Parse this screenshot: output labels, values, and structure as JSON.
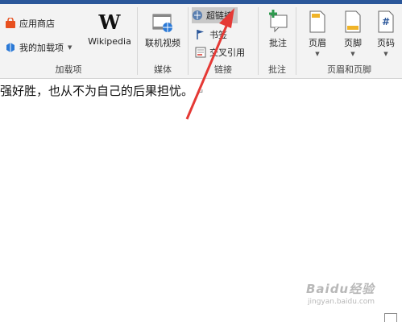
{
  "ribbon": {
    "addins": {
      "store_label": "应用商店",
      "my_addins_label": "我的加载项",
      "wikipedia_label": "Wikipedia",
      "group_label": "加载项"
    },
    "media": {
      "online_video_label": "联机视频",
      "group_label": "媒体"
    },
    "links": {
      "hyperlink_label": "超链接",
      "bookmark_label": "书签",
      "cross_ref_label": "交叉引用",
      "group_label": "链接"
    },
    "comments": {
      "comment_label": "批注",
      "group_label": "批注"
    },
    "header_footer": {
      "header_label": "页眉",
      "footer_label": "页脚",
      "page_number_label": "页码",
      "group_label": "页眉和页脚"
    }
  },
  "document": {
    "text": "强好胜，也从不为自己的后果担忧。",
    "paragraph_mark": "↵"
  },
  "watermark": {
    "main": "Baidu经验",
    "sub": "jingyan.baidu.com"
  },
  "colors": {
    "title_bar": "#2b579a",
    "ribbon_bg": "#f3f3f3",
    "arrow": "#e53935",
    "store_icon": "#e8501f",
    "addin_icon": "#2b79d6"
  },
  "icons": {
    "store": "store-icon",
    "my_addins": "my-addins-icon",
    "wikipedia": "wikipedia-icon",
    "online_video": "online-video-icon",
    "hyperlink": "hyperlink-icon",
    "bookmark": "bookmark-icon",
    "cross_reference": "cross-reference-icon",
    "comment": "comment-icon",
    "header": "header-icon",
    "footer": "footer-icon",
    "page_number": "page-number-icon"
  }
}
